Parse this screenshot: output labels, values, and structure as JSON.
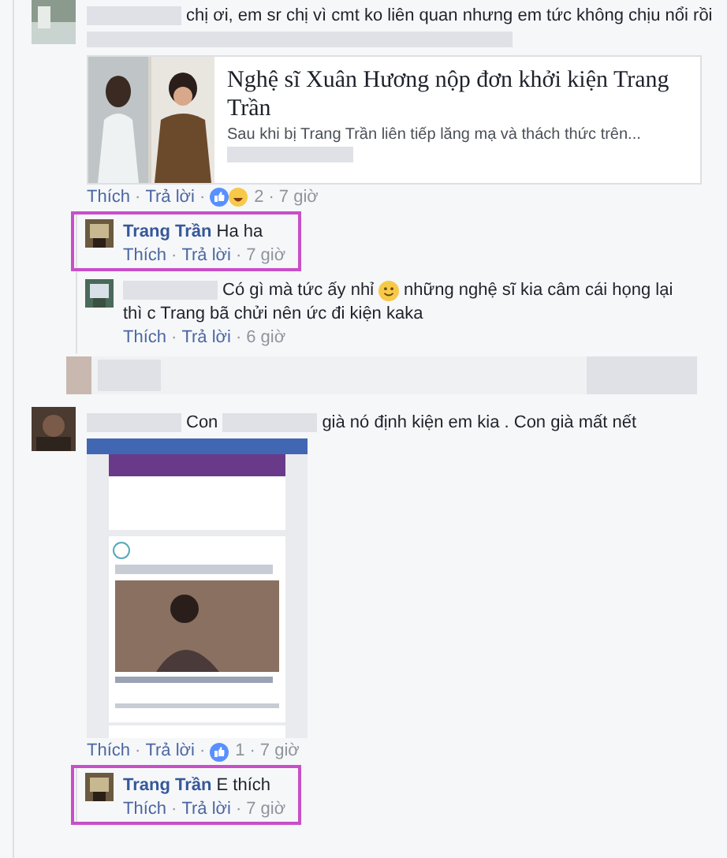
{
  "separator": "·",
  "comments": [
    {
      "segments": [
        {
          "kind": "blur"
        },
        {
          "kind": "text",
          "text": "chị ơi, em sr chị vì cmt ko liên quan nhưng em tức không chịu nổi rồi"
        },
        {
          "kind": "blurline"
        }
      ],
      "attachment": {
        "kind": "link",
        "title": "Nghệ sĩ Xuân Hương nộp đơn khởi kiện Trang Trần",
        "description": "Sau khi bị Trang Trần liên tiếp lăng mạ và thách thức trên..."
      },
      "actions": {
        "like": "Thích",
        "reply": "Trả lời",
        "reactions": [
          {
            "kind": "like"
          },
          {
            "kind": "haha"
          }
        ],
        "reaction_count": "2",
        "time": "7 giờ"
      },
      "replies": [
        {
          "author": "Trang Trần",
          "highlighted": true,
          "segments": [
            {
              "kind": "text",
              "text": "Ha ha"
            }
          ],
          "actions": {
            "like": "Thích",
            "reply": "Trả lời",
            "time": "7 giờ"
          }
        },
        {
          "highlighted": false,
          "segments": [
            {
              "kind": "blur"
            },
            {
              "kind": "text",
              "text": "Có gì mà tức ấy nhỉ"
            },
            {
              "kind": "emoji"
            },
            {
              "kind": "text",
              "text": "những nghệ sĩ kia câm cái họng lại"
            },
            {
              "kind": "text",
              "text": "thì c Trang bã chửi nên ức đi kiện kaka"
            }
          ],
          "actions": {
            "like": "Thích",
            "reply": "Trả lời",
            "time": "6 giờ"
          }
        }
      ],
      "collapsed_rows": [
        {
          "kind": "redacted"
        }
      ]
    },
    {
      "segments": [
        {
          "kind": "blur"
        },
        {
          "kind": "text",
          "text": "Con"
        },
        {
          "kind": "blur"
        },
        {
          "kind": "text",
          "text": "già nó định kiện em kia . Con già mất nết"
        }
      ],
      "attachment": {
        "kind": "screenshot"
      },
      "actions": {
        "like": "Thích",
        "reply": "Trả lời",
        "reactions": [
          {
            "kind": "like"
          }
        ],
        "reaction_count": "1",
        "time": "7 giờ"
      },
      "replies": [
        {
          "author": "Trang Trần",
          "highlighted": true,
          "segments": [
            {
              "kind": "text",
              "text": "E thích"
            }
          ],
          "actions": {
            "like": "Thích",
            "reply": "Trả lời",
            "time": "7 giờ"
          }
        }
      ]
    }
  ]
}
